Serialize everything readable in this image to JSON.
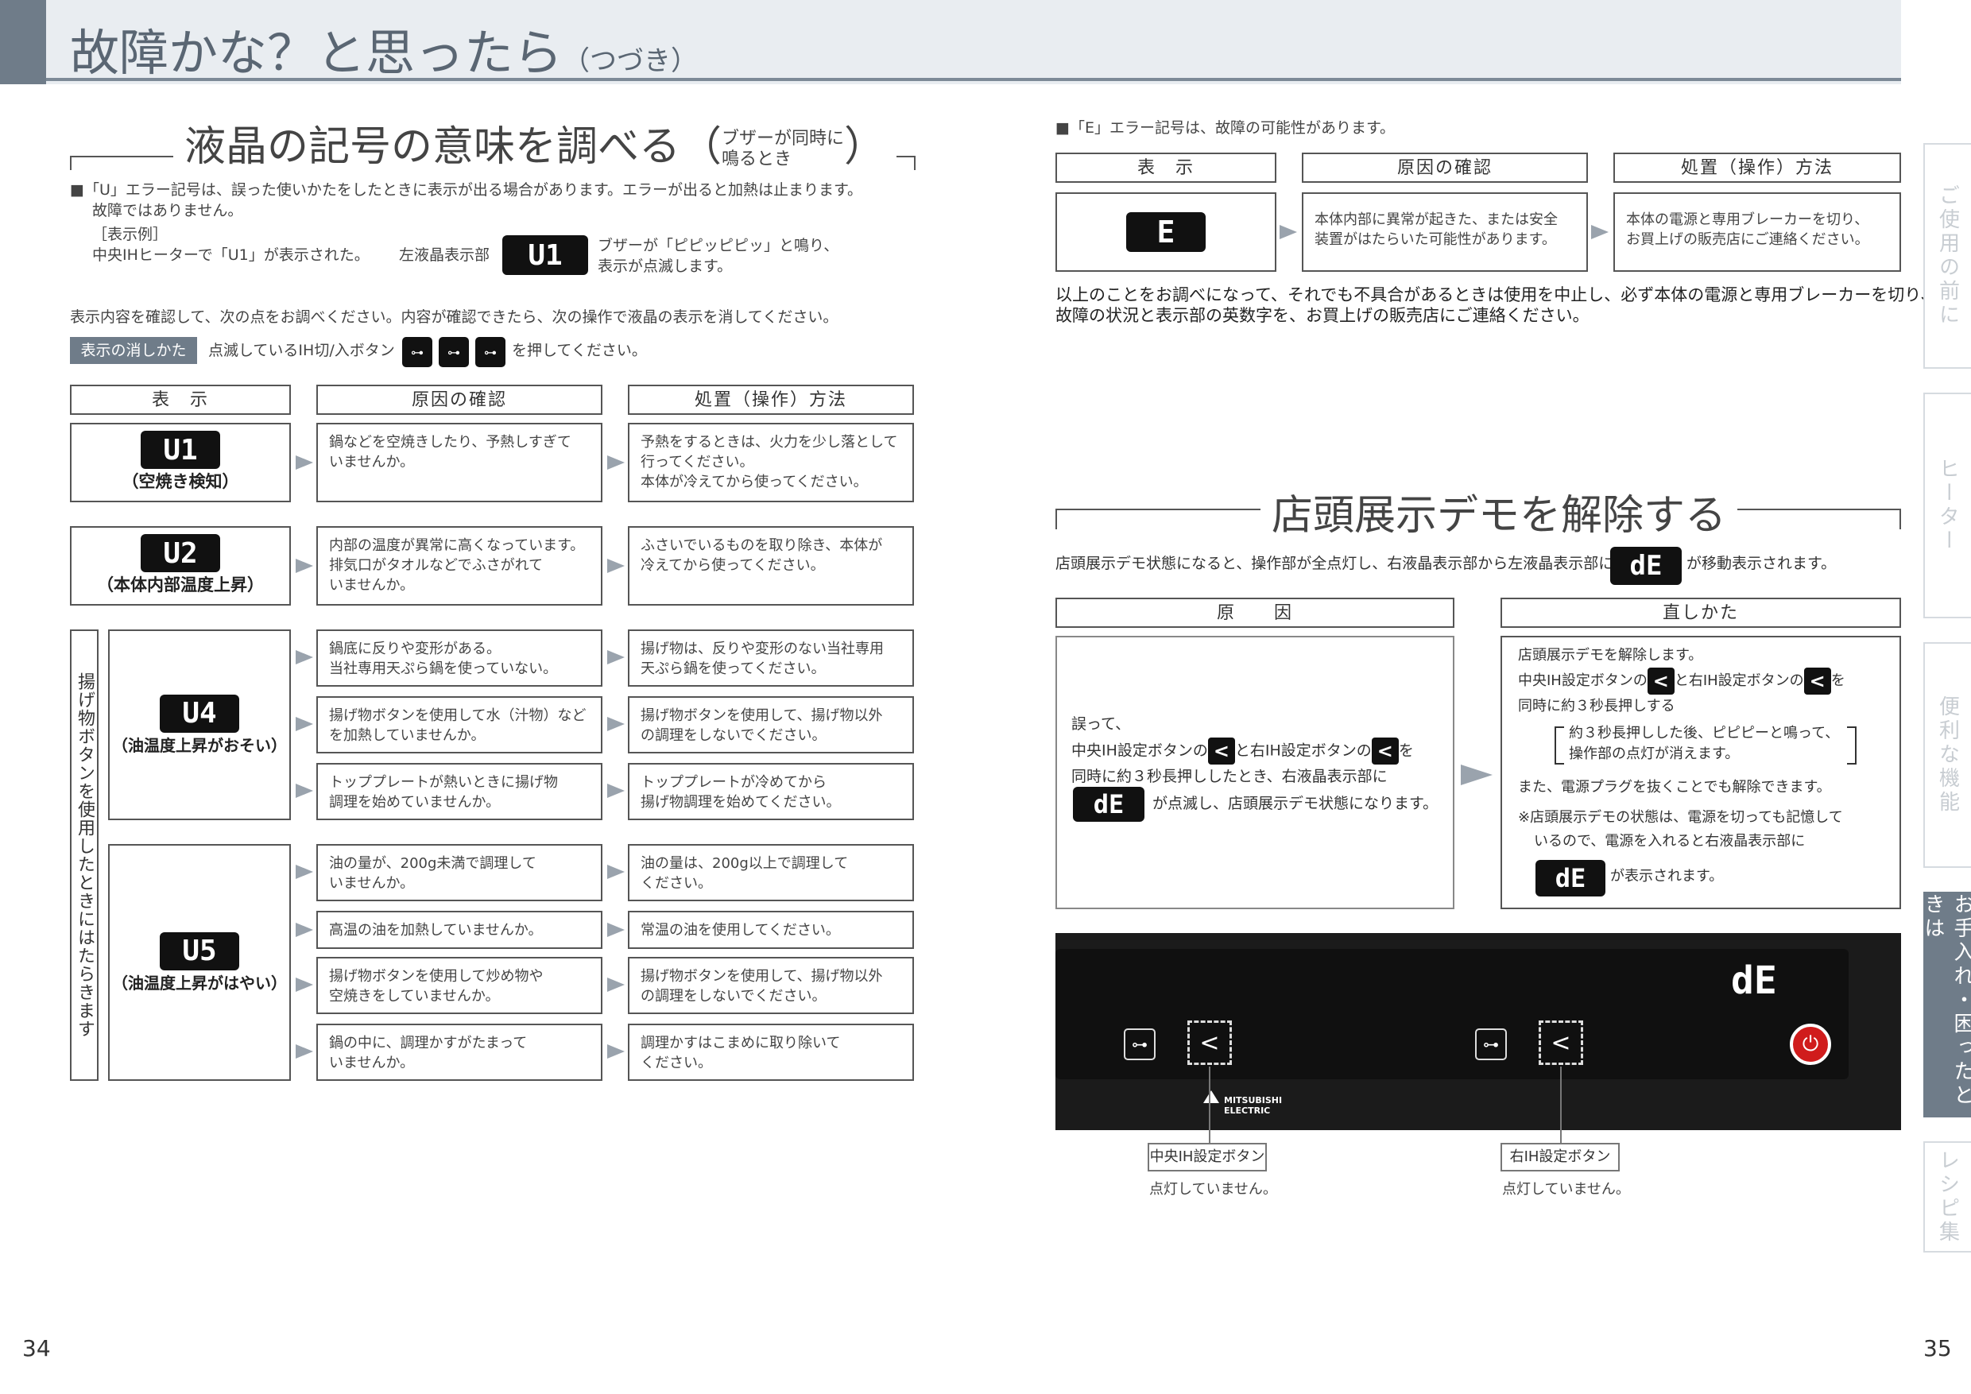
{
  "header": {
    "title": "故障かな？と思ったら",
    "title_sub": "（つづき）"
  },
  "left": {
    "section_title": "液晶の記号の意味を調べる",
    "section_sub1": "ブザーが同時に",
    "section_sub2": "鳴るとき",
    "paren_open": "（",
    "paren_close": "）",
    "intro1": "■「U」エラー記号は、誤った使いかたをしたときに表示が出る場合があります。エラーが出ると加熱は止まります。",
    "intro2": "故障ではありません。",
    "example_label": "［表示例］",
    "example_text": "中央IHヒーターで「U1」が表示された。",
    "example_lcd_label": "左液晶表示部",
    "example_lcd": "U1",
    "example_note1": "ブザーが「ピピッピピッ」と鳴り、",
    "example_note2": "表示が点滅します。",
    "check_text": "表示内容を確認して、次の点をお調べください。内容が確認できたら、次の操作で液晶の表示を消してください。",
    "erase_label": "表示の消しかた",
    "erase_text1": "点滅しているIH切/入ボタン",
    "erase_text2": "を押してください。",
    "erase_icon": "⊶",
    "col_display": "表　示",
    "col_cause": "原因の確認",
    "col_action": "処置（操作）方法",
    "fry_label": "揚げ物ボタンを使用したときにはたらきます",
    "rows": [
      {
        "code": "U1",
        "caption": "（空焼き検知）",
        "cause": "鍋などを空焼きしたり、予熱しすぎて\nいませんか。",
        "action": "予熱をするときは、火力を少し落として\n行ってください。\n本体が冷えてから使ってください。"
      },
      {
        "code": "U2",
        "caption": "（本体内部温度上昇）",
        "cause": "内部の温度が異常に高くなっています。\n排気口がタオルなどでふさがれて\nいませんか。",
        "action": "ふさいでいるものを取り除き、本体が\n冷えてから使ってください。"
      }
    ],
    "u4": {
      "code": "U4",
      "caption": "（油温度上昇がおそい）",
      "items": [
        {
          "cause": "鍋底に反りや変形がある。\n当社専用天ぷら鍋を使っていない。",
          "action": "揚げ物は、反りや変形のない当社専用\n天ぷら鍋を使ってください。"
        },
        {
          "cause": "揚げ物ボタンを使用して水（汁物）など\nを加熱していませんか。",
          "action": "揚げ物ボタンを使用して、揚げ物以外\nの調理をしないでください。"
        },
        {
          "cause": "トッププレートが熱いときに揚げ物\n調理を始めていませんか。",
          "action": "トッププレートが冷めてから\n揚げ物調理を始めてください。"
        }
      ]
    },
    "u5": {
      "code": "U5",
      "caption": "（油温度上昇がはやい）",
      "items": [
        {
          "cause": "油の量が、200g未満で調理して\nいませんか。",
          "action": "油の量は、200g以上で調理して\nください。"
        },
        {
          "cause": "高温の油を加熱していませんか。",
          "action": "常温の油を使用してください。"
        },
        {
          "cause": "揚げ物ボタンを使用して炒め物や\n空焼きをしていませんか。",
          "action": "揚げ物ボタンを使用して、揚げ物以外\nの調理をしないでください。"
        },
        {
          "cause": "鍋の中に、調理かすがたまって\nいませんか。",
          "action": "調理かすはこまめに取り除いて\nください。"
        }
      ]
    }
  },
  "right": {
    "e_intro": "■「E」エラー記号は、故障の可能性があります。",
    "col_display": "表　示",
    "col_cause": "原因の確認",
    "col_action": "処置（操作）方法",
    "e_code": "E",
    "e_cause": "本体内部に異常が起きた、または安全\n装置がはたらいた可能性があります。",
    "e_action": "本体の電源と専用ブレーカーを切り、\nお買上げの販売店にご連絡ください。",
    "e_note1": "以上のことをお調べになって、それでも不具合があるときは使用を中止し、必ず本体の電源と専用ブレーカーを切り、",
    "e_note2": "故障の状況と表示部の英数字を、お買上げの販売店にご連絡ください。",
    "demo_title": "店頭展示デモを解除する",
    "demo_intro1": "店頭展示デモ状態になると、操作部が全点灯し、右液晶表示部から左液晶表示部に",
    "demo_intro2": "が移動表示されます。",
    "demo_code": "dE",
    "col_reason": "原　　因",
    "col_fix": "直しかた",
    "reason1": "誤って、",
    "reason2a": "中央IH設定ボタンの",
    "reason2b": "と右IH設定ボタンの",
    "reason2c": "を",
    "reason3": "同時に約３秒長押ししたとき、右液晶表示部に",
    "reason4": "が点滅し、店頭展示デモ状態になります。",
    "lt": "<",
    "fix1": "店頭展示デモを解除します。",
    "fix2a": "中央IH設定ボタンの",
    "fix2b": "と右IH設定ボタンの",
    "fix2c": "を",
    "fix3": "同時に約３秒長押しする",
    "fix4": "約３秒長押しした後、ピピピーと鳴って、",
    "fix5": "操作部の点灯が消えます。",
    "fix6": "また、電源プラグを抜くことでも解除できます。",
    "fix7": "※店頭展示デモの状態は、電源を切っても記憶して",
    "fix8": "いるので、電源を入れると右液晶表示部に",
    "fix9": "が表示されます。",
    "panel_code": "dE",
    "brand1": "MITSUBISHI",
    "brand2": "ELECTRIC",
    "label_center": "中央IH設定ボタン",
    "label_right": "右IH設定ボタン",
    "off_text": "点灯していません。"
  },
  "tabs": [
    "ご使用の前に",
    "ヒーター",
    "便利な機能",
    "お手入れ・困ったときは",
    "レシピ集"
  ],
  "page_left": "34",
  "page_right": "35"
}
